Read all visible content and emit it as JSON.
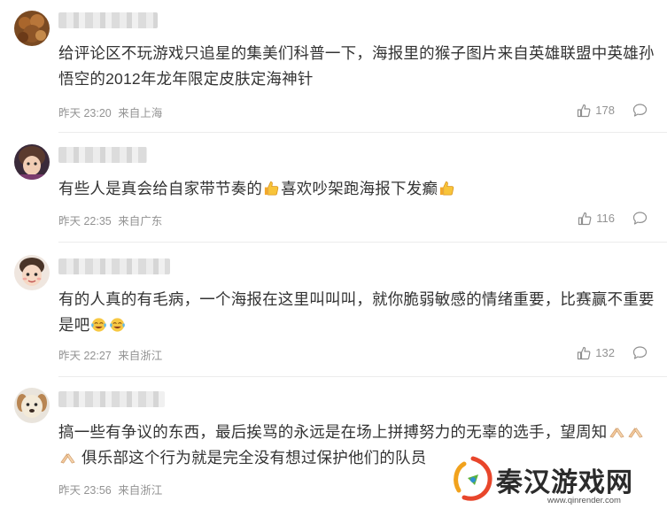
{
  "comments": [
    {
      "text": "给评论区不玩游戏只追星的集美们科普一下，海报里的猴子图片来自英雄联盟中英雄孙悟空的2012年龙年限定皮肤定海神针",
      "time": "昨天 23:20",
      "location": "来自上海",
      "likes": "178"
    },
    {
      "text_a": "有些人是真会给自家带节奏的",
      "text_b": "喜欢吵架跑海报下发癫",
      "time": "昨天 22:35",
      "location": "来自广东",
      "likes": "116"
    },
    {
      "text": "有的人真的有毛病，一个海报在这里叫叫叫，就你脆弱敏感的情绪重要，比赛赢不重要是吧",
      "time": "昨天 22:27",
      "location": "来自浙江",
      "likes": "132"
    },
    {
      "text_a": "搞一些有争议的东西，最后挨骂的永远是在场上拼搏努力的无辜的选手，望周知",
      "text_b": " 俱乐部这个行为就是完全没有想过保护他们的队员",
      "time": "昨天 23:56",
      "location": "来自浙江"
    }
  ],
  "watermark": {
    "title": "秦汉游戏网",
    "url": "www.qinrender.com"
  },
  "icons": {
    "like": "thumbs-up-icon",
    "reply": "speech-bubble-icon"
  },
  "colors": {
    "meta_text": "#939393",
    "body_text": "#333333",
    "divider": "#ececec"
  }
}
